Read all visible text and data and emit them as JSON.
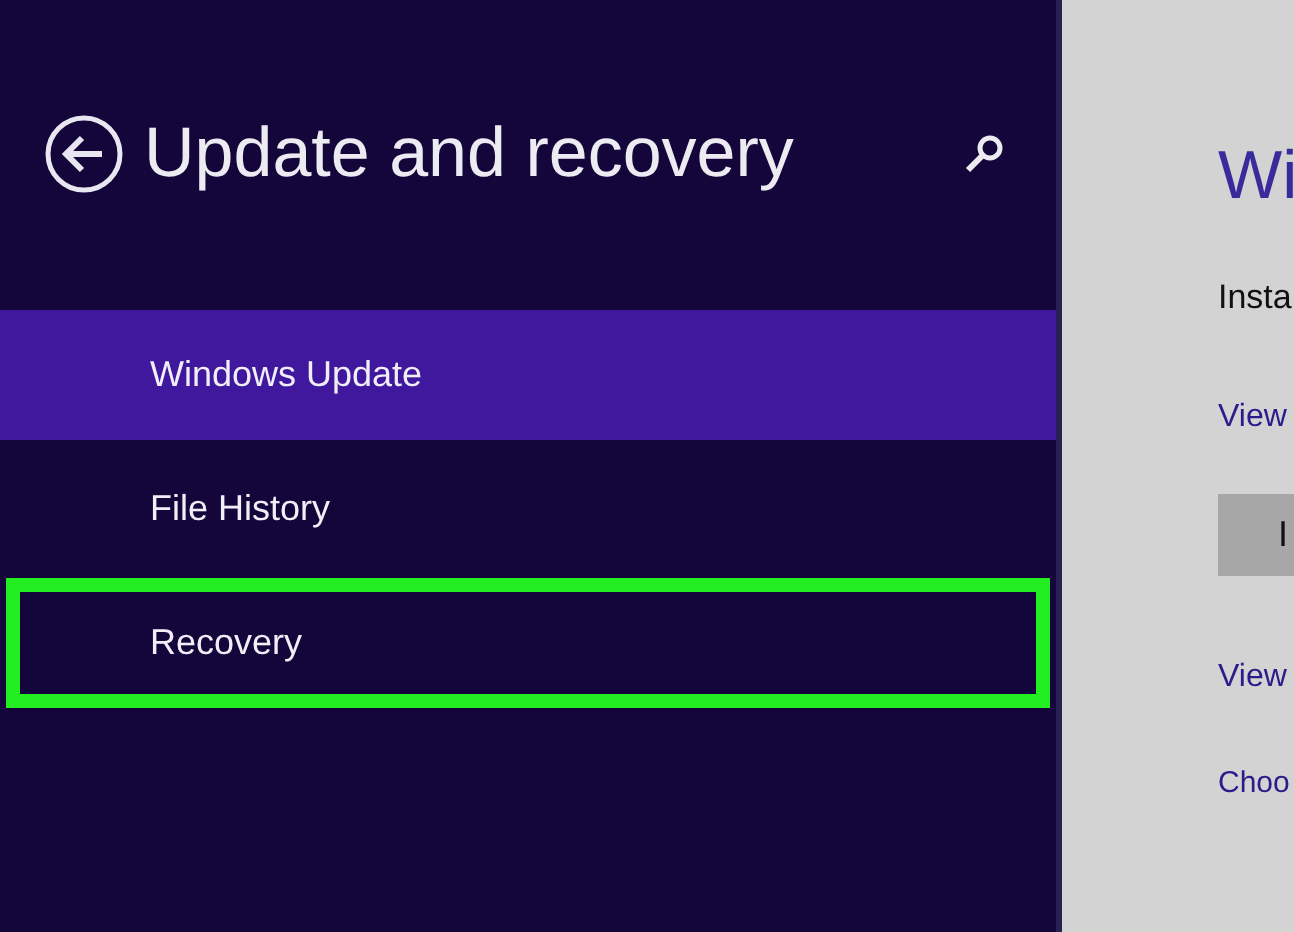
{
  "sidebar": {
    "title": "Update and recovery",
    "items": [
      {
        "label": "Windows Update",
        "selected": true,
        "highlighted": false
      },
      {
        "label": "File History",
        "selected": false,
        "highlighted": false
      },
      {
        "label": "Recovery",
        "selected": false,
        "highlighted": true
      }
    ]
  },
  "content": {
    "heading": "Wi",
    "text": "Insta",
    "link_1": "View",
    "button": "I",
    "link_2": "View",
    "link_3": "Choo"
  }
}
